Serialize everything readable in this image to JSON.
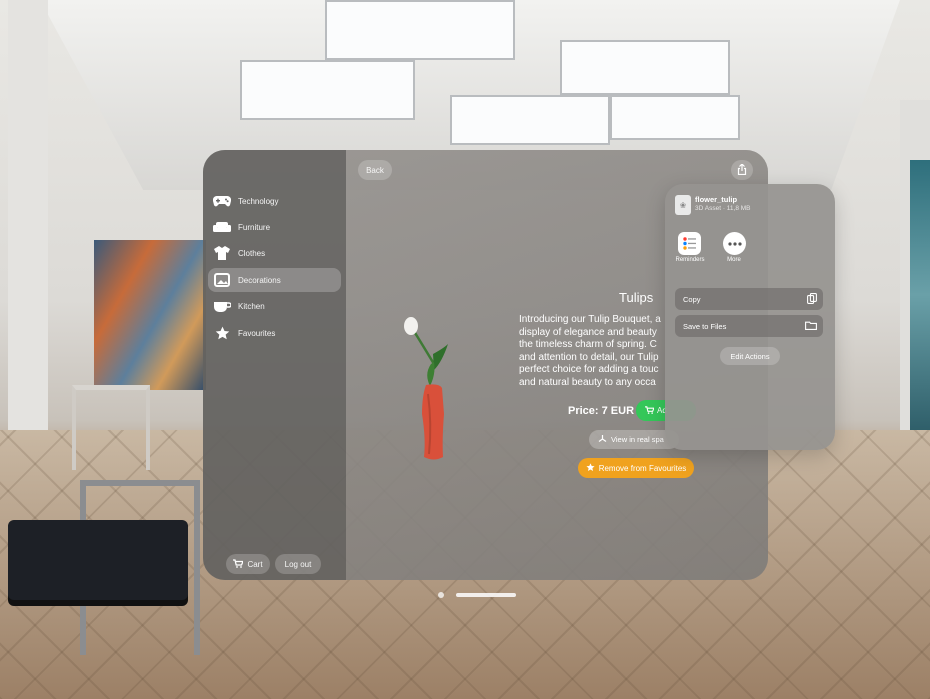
{
  "sidebar": {
    "items": [
      {
        "label": "Technology",
        "icon": "gamecontroller-icon"
      },
      {
        "label": "Furniture",
        "icon": "sofa-icon"
      },
      {
        "label": "Clothes",
        "icon": "tshirt-icon"
      },
      {
        "label": "Decorations",
        "icon": "photo-frame-icon",
        "active": true
      },
      {
        "label": "Kitchen",
        "icon": "cup-icon"
      },
      {
        "label": "Favourites",
        "icon": "star-icon"
      }
    ],
    "cart_label": "Cart",
    "logout_label": "Log out"
  },
  "toolbar": {
    "back_label": "Back",
    "share_icon": "share-icon"
  },
  "product": {
    "title": "Tulips",
    "description_lines": [
      "Introducing our Tulip Bouquet, a",
      "display of elegance and beauty",
      "the timeless charm of spring. C",
      "and attention to detail, our Tulip",
      "perfect choice for adding a touc",
      "and natural beauty to any occa"
    ],
    "price": "Price: 7 EUR",
    "add_label": "Ad",
    "view_label": "View in real spa",
    "favourite_label": "Remove from Favourites"
  },
  "share_sheet": {
    "file_name": "flower_tulip",
    "file_meta": "3D Asset · 11,8 MB",
    "apps": [
      {
        "label": "Reminders",
        "icon": "reminders-icon"
      },
      {
        "label": "More",
        "icon": "more-icon"
      }
    ],
    "actions": [
      {
        "label": "Copy",
        "icon": "copy-icon"
      },
      {
        "label": "Save to Files",
        "icon": "folder-icon"
      }
    ],
    "edit_actions_label": "Edit Actions"
  },
  "colors": {
    "accent_green": "#34c759",
    "favourite_orange": "#f0a21e",
    "vase_red": "#d9503a"
  }
}
